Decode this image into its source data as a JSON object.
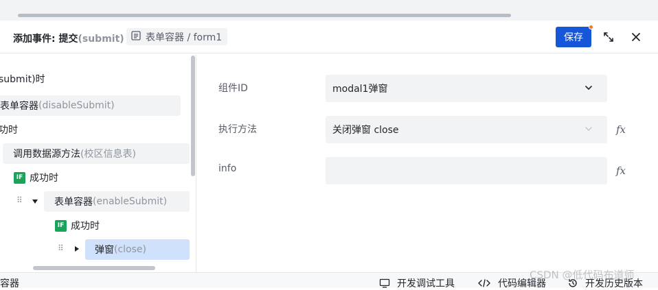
{
  "header": {
    "title_prefix": "添加事件: 提交",
    "title_event": "(submit)",
    "breadcrumb": "表单容器 / form1",
    "save_label": "保存"
  },
  "tree": {
    "row1": {
      "text": "submit)时"
    },
    "row2": {
      "text": "表单容器",
      "hint": " (disableSubmit)"
    },
    "row3": {
      "text": "功时"
    },
    "row4": {
      "text": "调用数据源方法",
      "hint": " (校区信息表)"
    },
    "row5": {
      "badge": "IF",
      "text": "成功时"
    },
    "row6": {
      "text": "表单容器",
      "hint": " (enableSubmit)"
    },
    "row7": {
      "badge": "IF",
      "text": "成功时"
    },
    "row8": {
      "text": "弹窗",
      "hint": " (close)"
    }
  },
  "form": {
    "component_label": "组件ID",
    "component_value": "modal1弹窗",
    "method_label": "执行方法",
    "method_value": "关闭弹窗 close",
    "info_label": "info",
    "info_value": "",
    "fx_symbol": "fx"
  },
  "footer": {
    "left_text": "容器",
    "debug_label": "开发调试工具",
    "code_label": "代码编辑器",
    "history_label": "开发历史版本"
  },
  "watermark": "CSDN @低代码布道师",
  "colors": {
    "primary": "#1557d8",
    "selected": "#d0e1fb",
    "badge": "#1ba35b",
    "dot": "#f07a2c"
  }
}
